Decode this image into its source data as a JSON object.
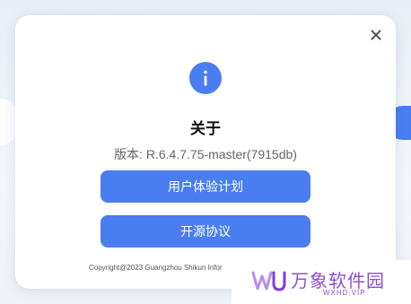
{
  "dialog": {
    "title": "关于",
    "version": "版本: R.6.4.7.75-master(7915db)",
    "buttons": {
      "user_experience": "用户体验计划",
      "open_source": "开源协议"
    },
    "copyright": "Copyright@2023 Guangzhou Shikun Infor"
  },
  "icons": {
    "close": "close-icon",
    "info": "info-icon"
  },
  "watermark": {
    "brand": "万象软件园",
    "site": "WXHD.VIP"
  },
  "colors": {
    "accent": "#4a7ef0",
    "watermark": "#8a4fd8"
  }
}
